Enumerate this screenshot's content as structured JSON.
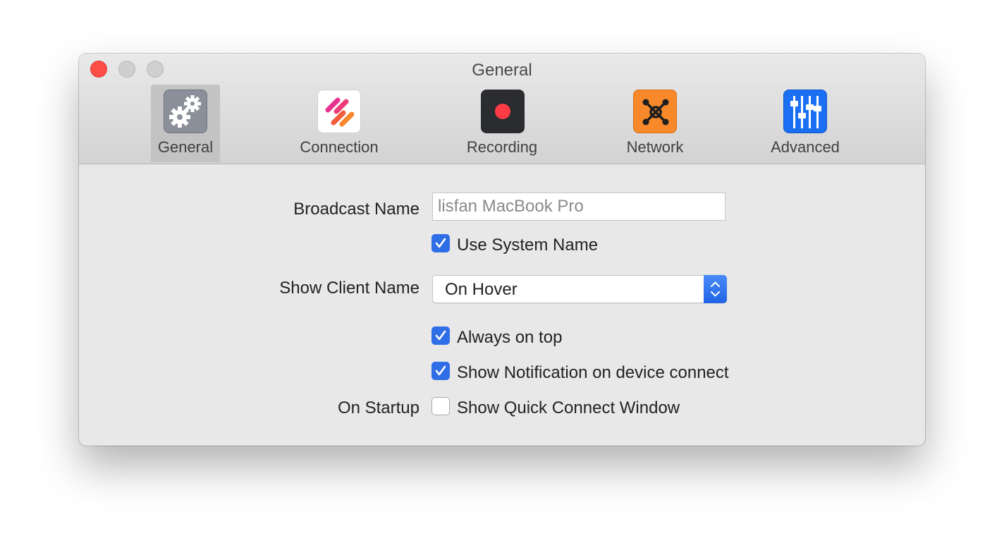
{
  "window": {
    "title": "General"
  },
  "toolbar": {
    "tabs": [
      {
        "label": "General",
        "icon": "gears-icon",
        "selected": true
      },
      {
        "label": "Connection",
        "icon": "connection-icon",
        "selected": false
      },
      {
        "label": "Recording",
        "icon": "record-icon",
        "selected": false
      },
      {
        "label": "Network",
        "icon": "network-icon",
        "selected": false
      },
      {
        "label": "Advanced",
        "icon": "sliders-icon",
        "selected": false
      }
    ]
  },
  "form": {
    "broadcast_name_label": "Broadcast Name",
    "broadcast_name_value": "lisfan MacBook Pro",
    "use_system_name_label": "Use System Name",
    "use_system_name_checked": true,
    "show_client_name_label": "Show Client Name",
    "show_client_name_value": "On Hover",
    "always_on_top_label": "Always on top",
    "always_on_top_checked": true,
    "show_notification_label": "Show Notification on device connect",
    "show_notification_checked": true,
    "on_startup_label": "On Startup",
    "show_quick_connect_label": "Show Quick Connect Window",
    "show_quick_connect_checked": false
  },
  "colors": {
    "accent": "#2f6ee6",
    "close": "#fc4e46",
    "recording_red": "#ff3b45",
    "network_orange": "#f7892a",
    "advanced_blue": "#1a6ff2"
  }
}
